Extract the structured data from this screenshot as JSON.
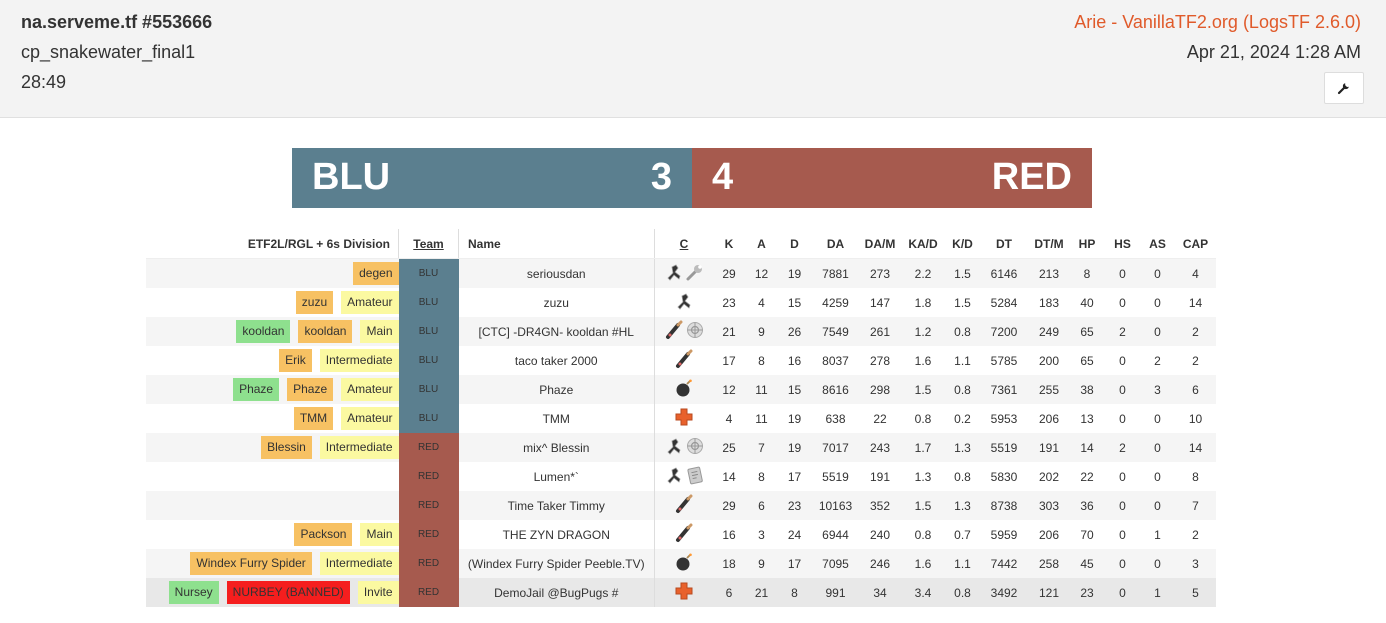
{
  "header": {
    "server_title": "na.serveme.tf #553666",
    "map": "cp_snakewater_final1",
    "duration": "28:49",
    "uploader": "Arie - VanillaTF2.org (LogsTF 2.6.0)",
    "date": "Apr 21, 2024 1:28 AM",
    "tool_icon": "wrench-icon"
  },
  "score": {
    "blu_label": "BLU",
    "blu_score": "3",
    "red_score": "4",
    "red_label": "RED"
  },
  "colors": {
    "blu": "#5b7f8f",
    "red": "#a65a4e",
    "link": "#e05a2a"
  },
  "table": {
    "headers": {
      "division": "ETF2L/RGL + 6s Division",
      "team": "Team",
      "name": "Name",
      "class": "C",
      "k": "K",
      "a": "A",
      "d": "D",
      "da": "DA",
      "dam": "DA/M",
      "kad": "KA/D",
      "kd": "K/D",
      "dt": "DT",
      "dtm": "DT/M",
      "hp": "HP",
      "hs": "HS",
      "as": "AS",
      "cap": "CAP"
    },
    "rows": [
      {
        "tags": [
          {
            "text": "degen",
            "color": "orange"
          }
        ],
        "team": "BLU",
        "name": "seriousdan",
        "classes": [
          "scout",
          "wrench"
        ],
        "k": "29",
        "a": "12",
        "d": "19",
        "da": "7881",
        "dam": "273",
        "kad": "2.2",
        "kd": "1.5",
        "dt": "6146",
        "dtm": "213",
        "hp": "8",
        "hs": "0",
        "as": "0",
        "cap": "4"
      },
      {
        "tags": [
          {
            "text": "zuzu",
            "color": "orange"
          },
          {
            "text": "Amateur",
            "color": "yellow"
          }
        ],
        "team": "BLU",
        "name": "zuzu",
        "classes": [
          "scout"
        ],
        "k": "23",
        "a": "4",
        "d": "15",
        "da": "4259",
        "dam": "147",
        "kad": "1.8",
        "kd": "1.5",
        "dt": "5284",
        "dtm": "183",
        "hp": "40",
        "hs": "0",
        "as": "0",
        "cap": "14"
      },
      {
        "tags": [
          {
            "text": "kooldan",
            "color": "green"
          },
          {
            "text": "kooldan",
            "color": "orange"
          },
          {
            "text": "Main",
            "color": "yellow"
          }
        ],
        "team": "BLU",
        "name": "[CTC] -DR4GN- kooldan #HL",
        "classes": [
          "soldier",
          "sniper"
        ],
        "k": "21",
        "a": "9",
        "d": "26",
        "da": "7549",
        "dam": "261",
        "kad": "1.2",
        "kd": "0.8",
        "dt": "7200",
        "dtm": "249",
        "hp": "65",
        "hs": "2",
        "as": "0",
        "cap": "2"
      },
      {
        "tags": [
          {
            "text": "Erik",
            "color": "orange"
          },
          {
            "text": "Intermediate",
            "color": "yellow"
          }
        ],
        "team": "BLU",
        "name": "taco taker 2000",
        "classes": [
          "soldier"
        ],
        "k": "17",
        "a": "8",
        "d": "16",
        "da": "8037",
        "dam": "278",
        "kad": "1.6",
        "kd": "1.1",
        "dt": "5785",
        "dtm": "200",
        "hp": "65",
        "hs": "0",
        "as": "2",
        "cap": "2"
      },
      {
        "tags": [
          {
            "text": "Phaze",
            "color": "green"
          },
          {
            "text": "Phaze",
            "color": "orange"
          },
          {
            "text": "Amateur",
            "color": "yellow"
          }
        ],
        "team": "BLU",
        "name": "Phaze",
        "classes": [
          "demoman"
        ],
        "k": "12",
        "a": "11",
        "d": "15",
        "da": "8616",
        "dam": "298",
        "kad": "1.5",
        "kd": "0.8",
        "dt": "7361",
        "dtm": "255",
        "hp": "38",
        "hs": "0",
        "as": "3",
        "cap": "6"
      },
      {
        "tags": [
          {
            "text": "TMM",
            "color": "orange"
          },
          {
            "text": "Amateur",
            "color": "yellow"
          }
        ],
        "team": "BLU",
        "name": "TMM",
        "classes": [
          "medic"
        ],
        "k": "4",
        "a": "11",
        "d": "19",
        "da": "638",
        "dam": "22",
        "kad": "0.8",
        "kd": "0.2",
        "dt": "5953",
        "dtm": "206",
        "hp": "13",
        "hs": "0",
        "as": "0",
        "cap": "10"
      },
      {
        "tags": [
          {
            "text": "Blessin",
            "color": "orange"
          },
          {
            "text": "Intermediate",
            "color": "yellow"
          }
        ],
        "team": "RED",
        "name": "mix^ Blessin",
        "classes": [
          "scout",
          "sniper"
        ],
        "k": "25",
        "a": "7",
        "d": "19",
        "da": "7017",
        "dam": "243",
        "kad": "1.7",
        "kd": "1.3",
        "dt": "5519",
        "dtm": "191",
        "hp": "14",
        "hs": "2",
        "as": "0",
        "cap": "14"
      },
      {
        "tags": [],
        "team": "RED",
        "name": "Lumen*`",
        "classes": [
          "scout",
          "spy"
        ],
        "k": "14",
        "a": "8",
        "d": "17",
        "da": "5519",
        "dam": "191",
        "kad": "1.3",
        "kd": "0.8",
        "dt": "5830",
        "dtm": "202",
        "hp": "22",
        "hs": "0",
        "as": "0",
        "cap": "8"
      },
      {
        "tags": [],
        "team": "RED",
        "name": "Time Taker Timmy",
        "classes": [
          "soldier"
        ],
        "k": "29",
        "a": "6",
        "d": "23",
        "da": "10163",
        "dam": "352",
        "kad": "1.5",
        "kd": "1.3",
        "dt": "8738",
        "dtm": "303",
        "hp": "36",
        "hs": "0",
        "as": "0",
        "cap": "7"
      },
      {
        "tags": [
          {
            "text": "Packson",
            "color": "orange"
          },
          {
            "text": "Main",
            "color": "yellow"
          }
        ],
        "team": "RED",
        "name": "THE ZYN DRAGON",
        "classes": [
          "soldier"
        ],
        "k": "16",
        "a": "3",
        "d": "24",
        "da": "6944",
        "dam": "240",
        "kad": "0.8",
        "kd": "0.7",
        "dt": "5959",
        "dtm": "206",
        "hp": "70",
        "hs": "0",
        "as": "1",
        "cap": "2"
      },
      {
        "tags": [
          {
            "text": "Windex Furry Spider",
            "color": "orange"
          },
          {
            "text": "Intermediate",
            "color": "yellow"
          }
        ],
        "team": "RED",
        "name": "(Windex Furry Spider Peeble.TV)",
        "classes": [
          "demoman"
        ],
        "k": "18",
        "a": "9",
        "d": "17",
        "da": "7095",
        "dam": "246",
        "kad": "1.6",
        "kd": "1.1",
        "dt": "7442",
        "dtm": "258",
        "hp": "45",
        "hs": "0",
        "as": "0",
        "cap": "3"
      },
      {
        "tags": [
          {
            "text": "Nursey",
            "color": "green"
          },
          {
            "text": "NURBEY (BANNED)",
            "color": "red"
          },
          {
            "text": "Invite",
            "color": "yellow"
          }
        ],
        "team": "RED",
        "name": "DemoJail @BugPugs #",
        "classes": [
          "medic"
        ],
        "k": "6",
        "a": "21",
        "d": "8",
        "da": "991",
        "dam": "34",
        "kad": "3.4",
        "kd": "0.8",
        "dt": "3492",
        "dtm": "121",
        "hp": "23",
        "hs": "0",
        "as": "1",
        "cap": "5"
      }
    ]
  }
}
